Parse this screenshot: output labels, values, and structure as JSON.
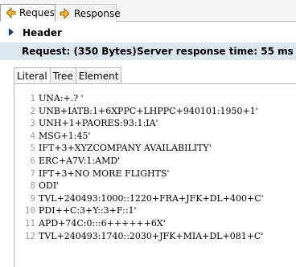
{
  "tabs": {
    "request": {
      "label": "Request",
      "icon": "request-arrow-icon"
    },
    "response": {
      "label": "Response",
      "icon": "response-arrow-icon"
    }
  },
  "header": {
    "label": "Header",
    "icon": "chevron-right-icon"
  },
  "info": {
    "request": "Request:  (350 Bytes)",
    "server_time": "Server response time: 55 ms"
  },
  "subtabs": [
    {
      "label": "Literal",
      "active": true
    },
    {
      "label": "Tree",
      "active": false
    },
    {
      "label": "Element",
      "active": false
    }
  ],
  "lines": [
    {
      "n": "1",
      "text": "UNA:+.? '"
    },
    {
      "n": "2",
      "text": "UNB+IATB:1+6XPPC+LHPPC+940101:1950+1'"
    },
    {
      "n": "3",
      "text": "UNH+1+PAORES:93:1:IA'"
    },
    {
      "n": "4",
      "text": "MSG+1:45'"
    },
    {
      "n": "5",
      "text": "IFT+3+XYZCOMPANY AVAILABILITY'"
    },
    {
      "n": "6",
      "text": "ERC+A7V:1:AMD'"
    },
    {
      "n": "7",
      "text": "IFT+3+NO MORE FLIGHTS'"
    },
    {
      "n": "8",
      "text": "ODI'"
    },
    {
      "n": "9",
      "text": "TVL+240493:1000::1220+FRA+JFK+DL+400+C'"
    },
    {
      "n": "10",
      "text": "PDI++C:3+Y::3+F::1'"
    },
    {
      "n": "11",
      "text": "APD+74C:0:::6++++++6X'"
    },
    {
      "n": "12",
      "text": "TVL+240493:1740::2030+JFK+MIA+DL+081+C'"
    }
  ]
}
